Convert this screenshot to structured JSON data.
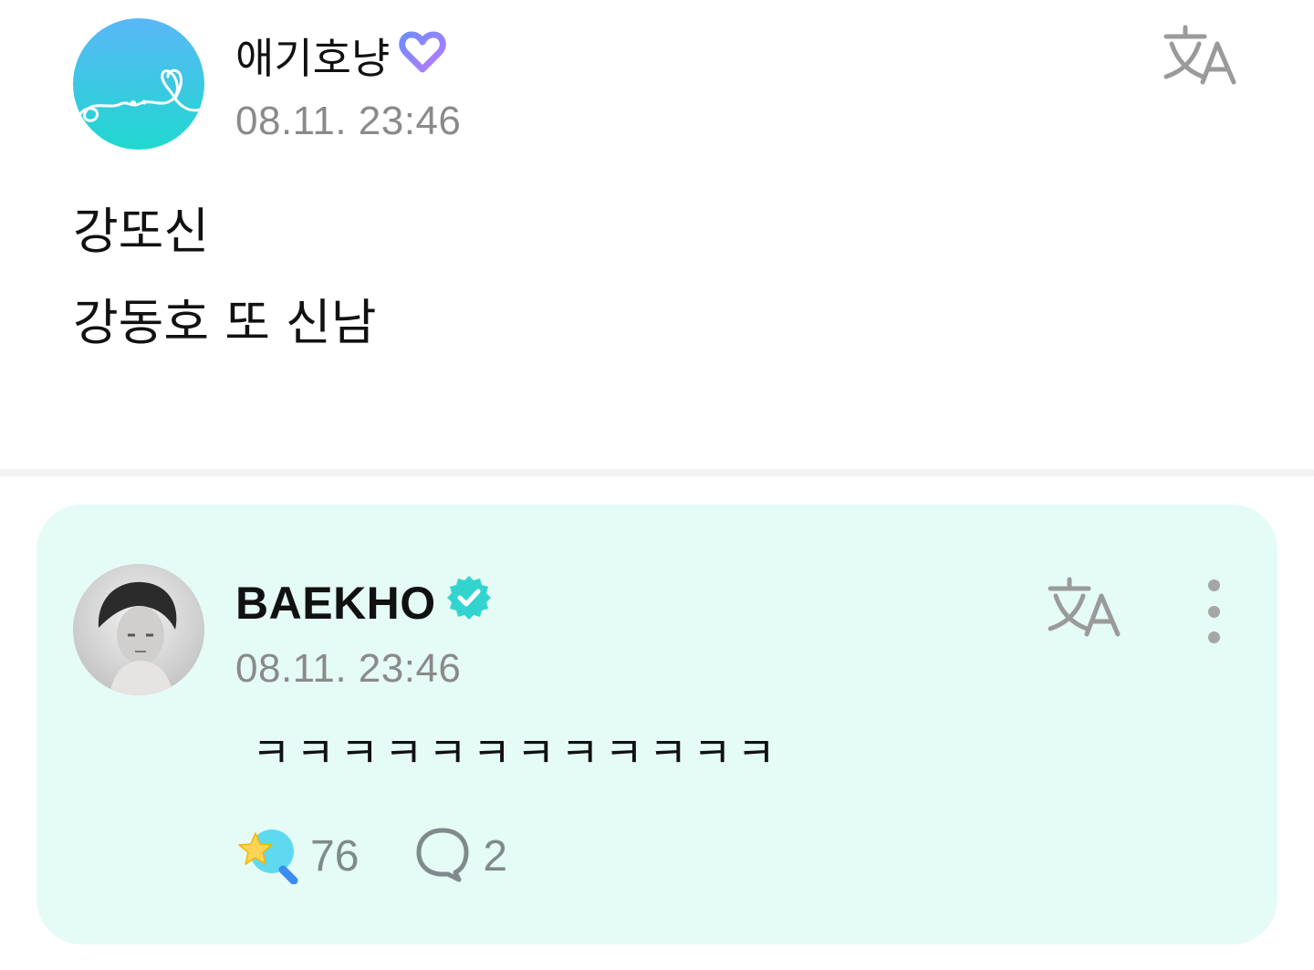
{
  "post": {
    "author": "애기호냥",
    "time": "08.11. 23:46",
    "lines": [
      "강또신",
      "강동호 또 신남"
    ]
  },
  "reply": {
    "author": "BAEKHO",
    "time": "08.11. 23:46",
    "text": "ㅋㅋㅋㅋㅋㅋㅋㅋㅋㅋㅋㅋ",
    "likes": "76",
    "comments": "2"
  },
  "colors": {
    "card_background": "#e5fbf5",
    "verified_badge": "#33d4d0",
    "fan_badge_gradient": [
      "#6f8dff",
      "#b77bff"
    ],
    "muted_text": "#8a8a8a"
  },
  "icons": {
    "post_badge": "heart-badge-icon",
    "reply_badge": "verified-badge-icon",
    "translate": "translate-icon",
    "more": "more-options-icon",
    "like": "star-wand-icon",
    "comment": "comment-bubble-icon"
  }
}
